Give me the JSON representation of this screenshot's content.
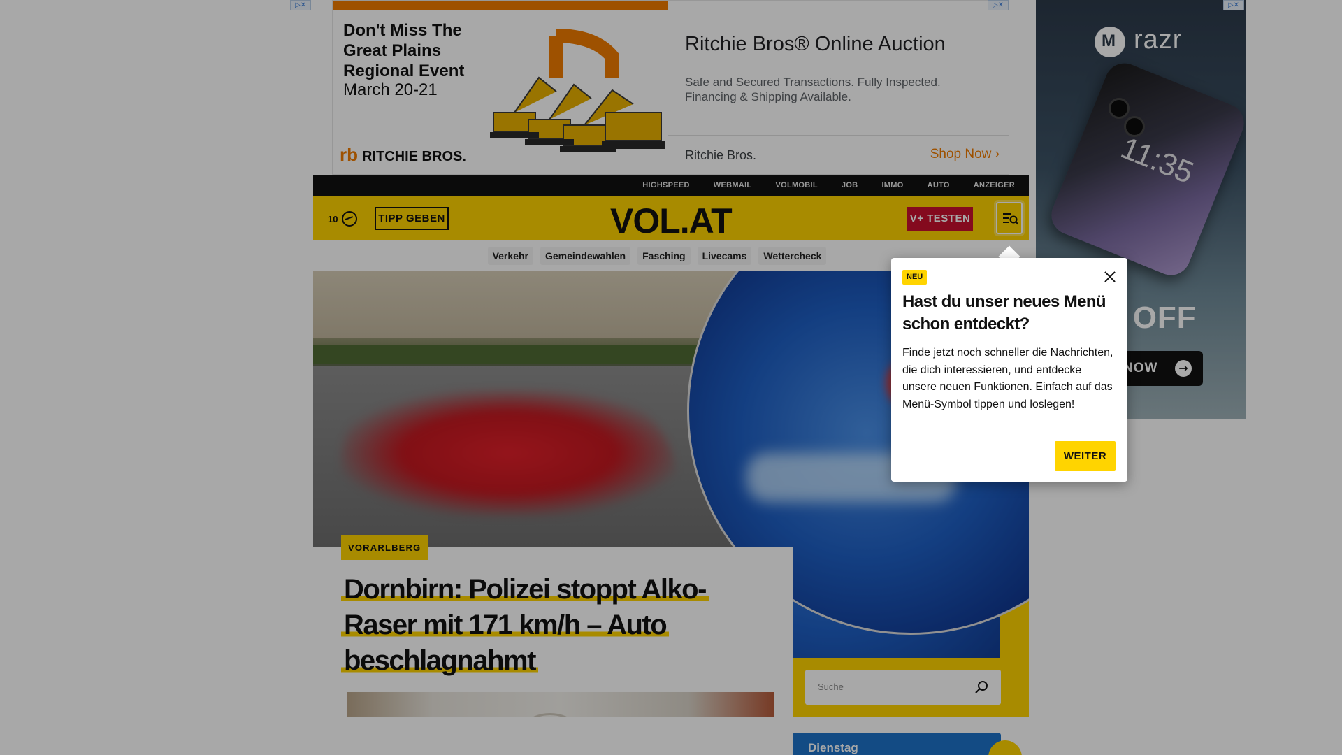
{
  "ad_top": {
    "headline": "Don't Miss The Great Plains Regional Event",
    "date": "March 20-21",
    "logo_text": "RITCHIE BROS.",
    "title": "Ritchie Bros® Online Auction",
    "description": "Safe and Secured Transactions. Fully Inspected. Financing & Shipping Available.",
    "brand": "Ritchie Bros.",
    "cta": "Shop Now",
    "accent_color": "#f07c00"
  },
  "top_nav": {
    "items": [
      "HIGHSPEED",
      "WEBMAIL",
      "VOLMOBIL",
      "JOB",
      "IMMO",
      "AUTO",
      "ANZEIGER"
    ]
  },
  "header": {
    "weather_temp": "10",
    "weather_icon": "weather-icon",
    "tipp_label": "TIPP GEBEN",
    "logo": "VOL.AT",
    "vplus_label": "V+ TESTEN",
    "menu_icon": "menu-search-icon",
    "brand_color": "#ffd400",
    "vplus_color": "#c8102e"
  },
  "subnav": {
    "items": [
      "Verkehr",
      "Gemeindewahlen",
      "Fasching",
      "Livecams",
      "Wettercheck"
    ]
  },
  "hero": {
    "tag": "VORARLBERG",
    "headline": "Dornbirn: Polizei stoppt Alko-Raser mit 171 km/h – Auto beschlagnahmt"
  },
  "search": {
    "placeholder": "Suche",
    "icon": "search-icon"
  },
  "day_card": {
    "label": "Dienstag"
  },
  "ad_side": {
    "brand": "razr",
    "time": "11:35",
    "offer": "0 OFF",
    "cta": "NOW"
  },
  "popup": {
    "badge": "NEU",
    "title": "Hast du unser neues Menü schon entdeckt?",
    "body": "Finde jetzt noch schneller die Nachrichten, die dich interessieren, und entdecke unsere neuen Funktionen. Einfach auf das Menü-Symbol tippen und loslegen!",
    "button": "WEITER"
  }
}
